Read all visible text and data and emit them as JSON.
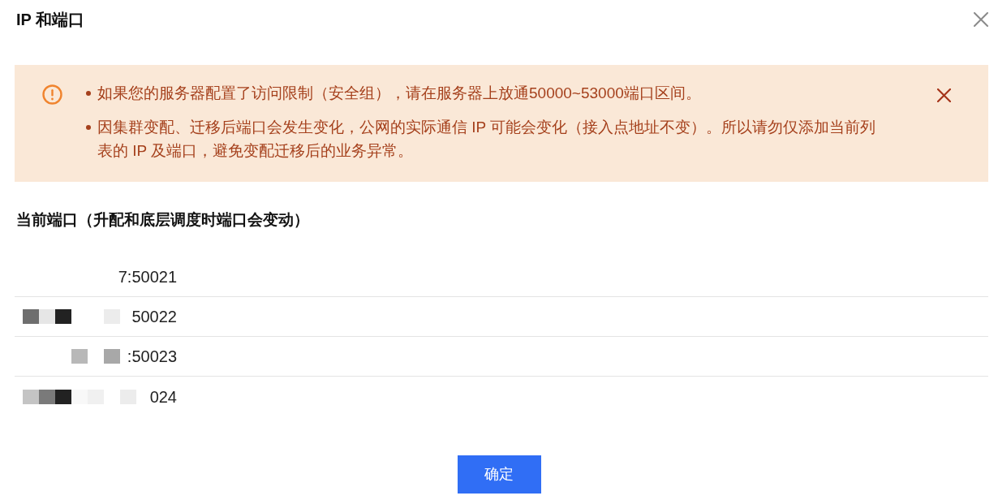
{
  "dialog": {
    "title": "IP 和端口"
  },
  "alert": {
    "messages": [
      "如果您的服务器配置了访问限制（安全组），请在服务器上放通50000~53000端口区间。",
      "因集群变配、迁移后端口会发生变化，公网的实际通信 IP 可能会变化（接入点地址不变）。所以请勿仅添加当前列表的 IP 及端口，避免变配迁移后的业务异常。"
    ]
  },
  "ports_section": {
    "heading": "当前端口（升配和底层调度时端口会变动）",
    "rows": [
      {
        "address": "7:50021"
      },
      {
        "address": "50022"
      },
      {
        "address": ":50023"
      },
      {
        "address": "024"
      }
    ]
  },
  "confirm_button": {
    "label": "确定"
  }
}
